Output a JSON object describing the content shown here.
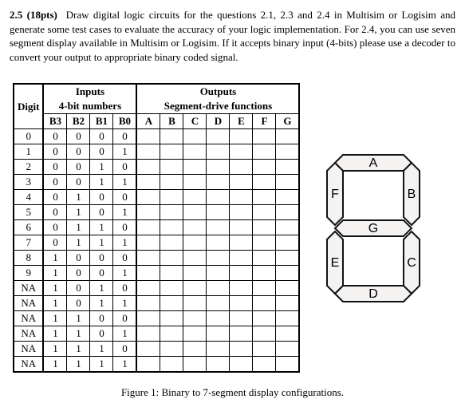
{
  "question": {
    "number": "2.5",
    "points": "(18pts)",
    "body": "Draw digital logic circuits for the questions 2.1, 2.3 and 2.4 in Multisim or Logisim and generate some test cases to evaluate the accuracy of your logic implementation. For 2.4, you can use seven segment display available in Multisim or Logisim. If it accepts binary input (4-bits) please use a decoder to convert your output to appropriate binary coded signal."
  },
  "table": {
    "top": {
      "digit": "Digit",
      "inputs": "Inputs",
      "outputs": "Outputs"
    },
    "sub": {
      "inputs": "4-bit numbers",
      "outputs": "Segment-drive functions"
    },
    "headers": {
      "b3": "B3",
      "b2": "B2",
      "b1": "B1",
      "b0": "B0",
      "a": "A",
      "b": "B",
      "c": "C",
      "d": "D",
      "e": "E",
      "f": "F",
      "g": "G"
    },
    "rows": [
      {
        "digit": "0",
        "b3": "0",
        "b2": "0",
        "b1": "0",
        "b0": "0"
      },
      {
        "digit": "1",
        "b3": "0",
        "b2": "0",
        "b1": "0",
        "b0": "1"
      },
      {
        "digit": "2",
        "b3": "0",
        "b2": "0",
        "b1": "1",
        "b0": "0"
      },
      {
        "digit": "3",
        "b3": "0",
        "b2": "0",
        "b1": "1",
        "b0": "1"
      },
      {
        "digit": "4",
        "b3": "0",
        "b2": "1",
        "b1": "0",
        "b0": "0"
      },
      {
        "digit": "5",
        "b3": "0",
        "b2": "1",
        "b1": "0",
        "b0": "1"
      },
      {
        "digit": "6",
        "b3": "0",
        "b2": "1",
        "b1": "1",
        "b0": "0"
      },
      {
        "digit": "7",
        "b3": "0",
        "b2": "1",
        "b1": "1",
        "b0": "1"
      },
      {
        "digit": "8",
        "b3": "1",
        "b2": "0",
        "b1": "0",
        "b0": "0"
      },
      {
        "digit": "9",
        "b3": "1",
        "b2": "0",
        "b1": "0",
        "b0": "1"
      },
      {
        "digit": "NA",
        "b3": "1",
        "b2": "0",
        "b1": "1",
        "b0": "0"
      },
      {
        "digit": "NA",
        "b3": "1",
        "b2": "0",
        "b1": "1",
        "b0": "1"
      },
      {
        "digit": "NA",
        "b3": "1",
        "b2": "1",
        "b1": "0",
        "b0": "0"
      },
      {
        "digit": "NA",
        "b3": "1",
        "b2": "1",
        "b1": "0",
        "b0": "1"
      },
      {
        "digit": "NA",
        "b3": "1",
        "b2": "1",
        "b1": "1",
        "b0": "0"
      },
      {
        "digit": "NA",
        "b3": "1",
        "b2": "1",
        "b1": "1",
        "b0": "1"
      }
    ]
  },
  "segments": {
    "a": "A",
    "b": "B",
    "c": "C",
    "d": "D",
    "e": "E",
    "f": "F",
    "g": "G"
  },
  "caption": "Figure 1: Binary to 7-segment display configurations."
}
